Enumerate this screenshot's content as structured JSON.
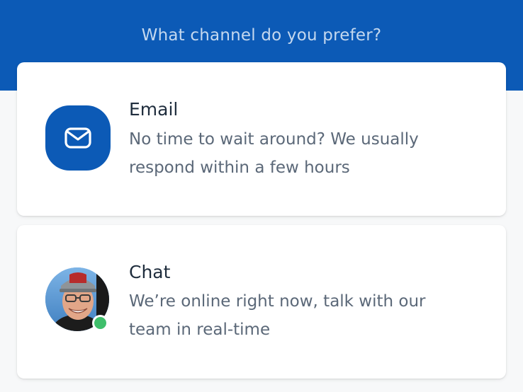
{
  "header": {
    "title": "What channel do you prefer?"
  },
  "colors": {
    "brand_blue": "#0c5ab6",
    "online_green": "#3fbf6b"
  },
  "channels": [
    {
      "icon": "envelope-icon",
      "title": "Email",
      "description": "No time to wait around? We usually respond within a few hours"
    },
    {
      "icon": "agent-avatar",
      "title": "Chat",
      "description": "We’re online right now, talk with our team in real-time",
      "status": "online"
    }
  ]
}
